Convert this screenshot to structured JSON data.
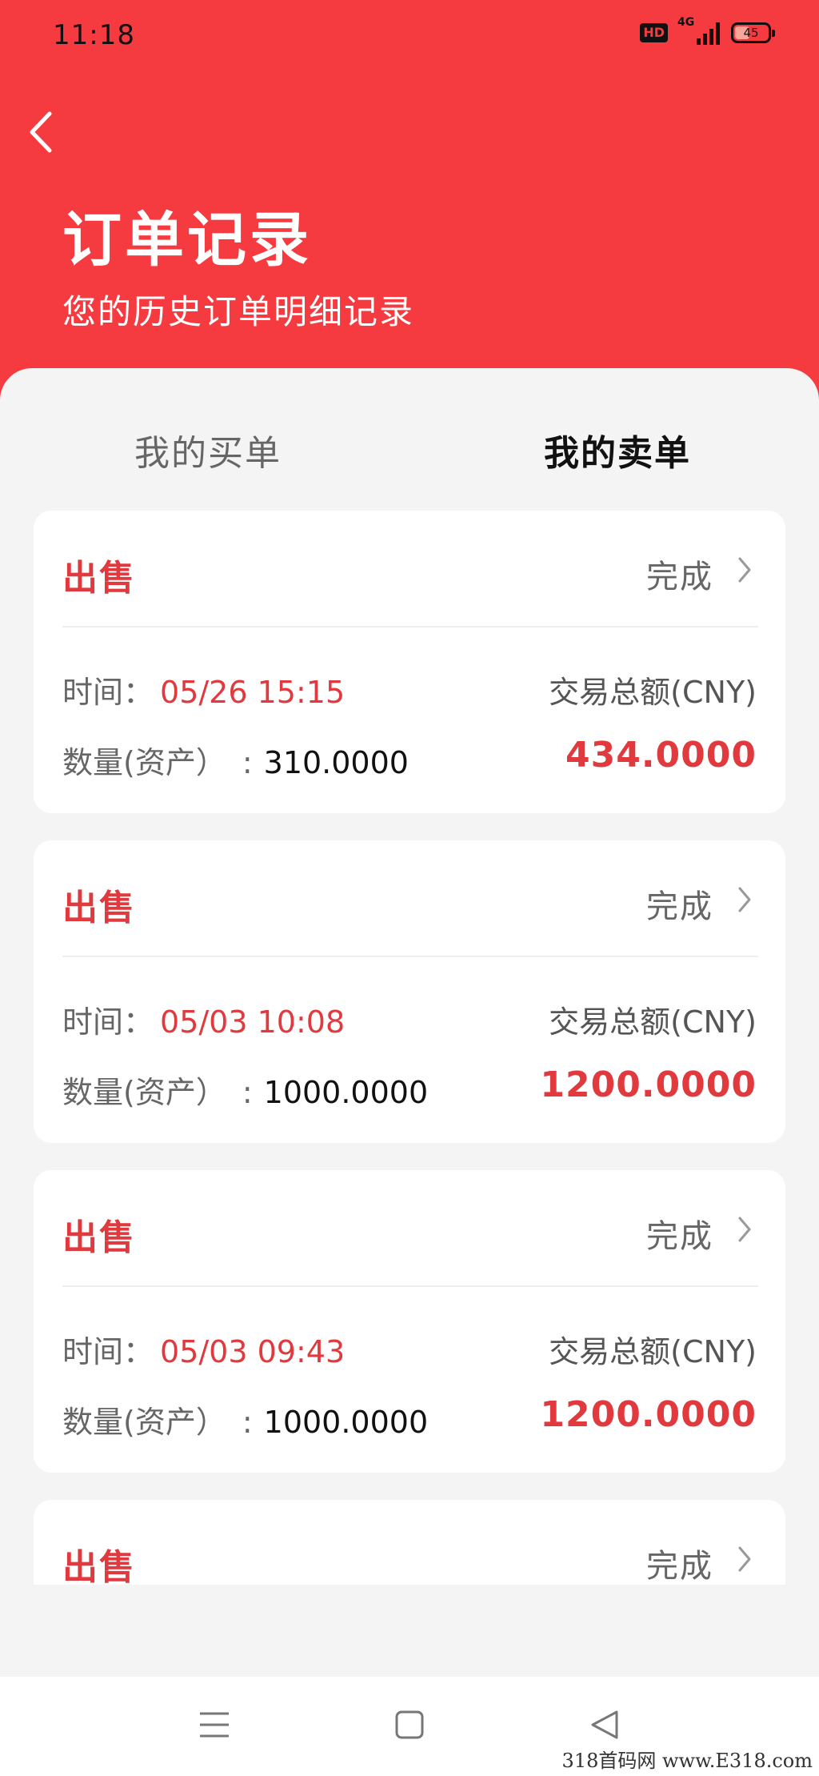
{
  "status_bar": {
    "time": "11:18",
    "hd_label": "HD",
    "network_label": "4G",
    "battery_level": 45,
    "battery_label": "45"
  },
  "header": {
    "back_icon": "chevron-left-icon",
    "title": "订单记录",
    "subtitle": "您的历史订单明细记录"
  },
  "tabs": [
    {
      "label": "我的买单",
      "active": false
    },
    {
      "label": "我的卖单",
      "active": true
    }
  ],
  "labels": {
    "time": "时间：",
    "quantity": "数量(资产）",
    "quantity_sep": ":",
    "total": "交易总额(CNY)"
  },
  "orders": [
    {
      "type": "出售",
      "status": "完成",
      "time": "05/26 15:15",
      "quantity": "310.0000",
      "amount": "434.0000"
    },
    {
      "type": "出售",
      "status": "完成",
      "time": "05/03 10:08",
      "quantity": "1000.0000",
      "amount": "1200.0000"
    },
    {
      "type": "出售",
      "status": "完成",
      "time": "05/03 09:43",
      "quantity": "1000.0000",
      "amount": "1200.0000"
    },
    {
      "type": "出售",
      "status": "完成"
    }
  ],
  "nav": {
    "menu_icon": "menu-icon",
    "home_icon": "square-home-icon",
    "back_icon": "triangle-back-icon"
  },
  "watermark": "318首码网 www.E318.com",
  "colors": {
    "accent": "#f63b40",
    "price_red": "#e0393e",
    "background": "#f4f4f4"
  }
}
